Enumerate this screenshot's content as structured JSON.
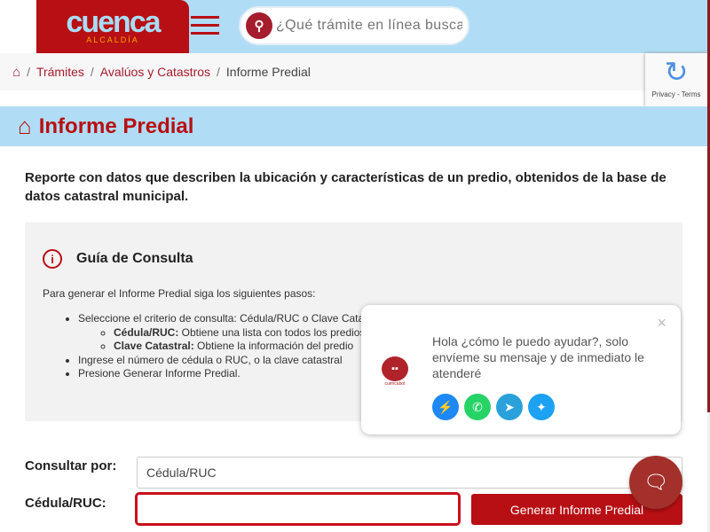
{
  "header": {
    "logo_name": "cuenca",
    "logo_sub": "ALCALDÍA",
    "search_placeholder": "¿Qué trámite en línea busca"
  },
  "breadcrumb": {
    "items": [
      "Trámites",
      "Avalúos y Catastros"
    ],
    "current": "Informe Predial",
    "sep": "/"
  },
  "recaptcha": {
    "text": "Privacy - Terms"
  },
  "page": {
    "title": "Informe Predial",
    "description": "Reporte con datos que describen la ubicación y características de un predio, obtenidos de la base de datos catastral municipal."
  },
  "guide": {
    "title": "Guía de Consulta",
    "intro": "Para generar el Informe Predial siga los siguientes pasos:",
    "step1": "Seleccione el criterio de consulta: Cédula/RUC o Clave Catastral.",
    "sub1_label": "Cédula/RUC:",
    "sub1_text": " Obtiene una lista con todos los predios",
    "sub2_label": "Clave Catastral:",
    "sub2_text": " Obtiene la información del predio",
    "step2": "Ingrese el número de cédula o RUC, o la clave catastral",
    "step3": "Presione Generar Informe Predial."
  },
  "form": {
    "consultar_label": "Consultar por:",
    "consultar_value": "Cédula/RUC",
    "cedula_label": "Cédula/RUC:",
    "cedula_value": "",
    "generate_label": "Generar Informe Predial"
  },
  "chat": {
    "message": "Hola ¿cómo le puedo ayudar?, solo envíeme su mensaje y de inmediato le atenderé",
    "bot_name": "cuencabot",
    "close": "×"
  },
  "colors": {
    "brand": "#b80f14",
    "sky": "#b0ddf5"
  }
}
